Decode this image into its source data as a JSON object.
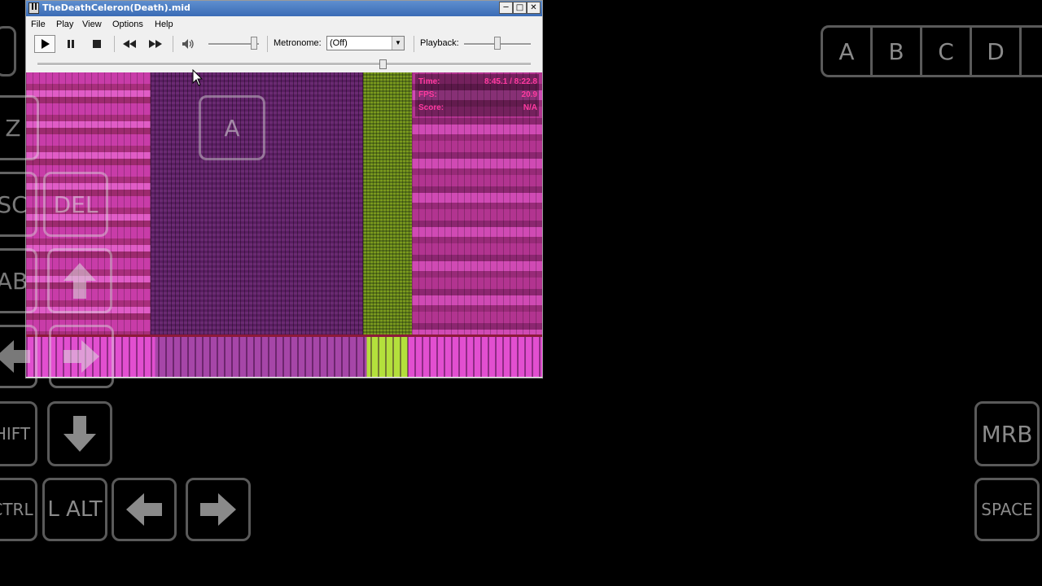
{
  "window": {
    "title": "TheDeathCeleron(Death).mid",
    "controls": {
      "minimize": "─",
      "maximize": "□",
      "close": "✕"
    }
  },
  "menu": [
    "File",
    "Play",
    "View",
    "Options",
    "Help"
  ],
  "toolbar": {
    "metronome_label": "Metronome:",
    "metronome_value": "(Off)",
    "playback_label": "Playback:",
    "volume_level": 0.9,
    "playback_speed": 0.5
  },
  "seek_position": 0.7,
  "stats": [
    {
      "key": "Time:",
      "value": "8:45.1 / 8:22.8"
    },
    {
      "key": "FPS:",
      "value": "20.9"
    },
    {
      "key": "Score:",
      "value": "N/A"
    }
  ],
  "colors": {
    "accent_pink": "#e24fd0",
    "accent_green": "#b4e03c",
    "key_border": "#5a5a5a"
  },
  "virtual_keys": {
    "top_right": [
      "A",
      "B",
      "C",
      "D"
    ],
    "a_key": "A",
    "z_key": "Z",
    "esc_key": "SC",
    "del_key": "DEL",
    "tab_key": "AB",
    "shift_key": "HIFT",
    "ctrl_key": "CTRL",
    "lalt_key": "L ALT",
    "mrb_key": "MRB",
    "space_key": "SPACE"
  }
}
